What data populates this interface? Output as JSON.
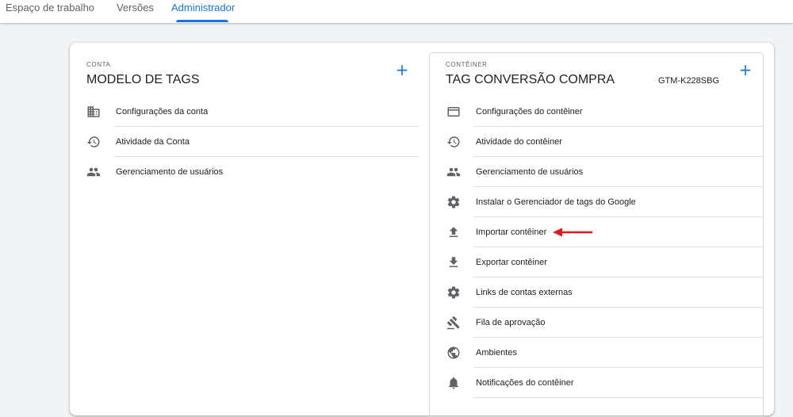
{
  "nav": {
    "tabs": [
      {
        "label": "Espaço de trabalho",
        "active": false
      },
      {
        "label": "Versões",
        "active": false
      },
      {
        "label": "Administrador",
        "active": true
      }
    ]
  },
  "account": {
    "eyebrow": "CONTA",
    "title": "MODELO DE TAGS",
    "add_label": "+",
    "items": [
      {
        "label": "Configurações da conta",
        "icon": "building-icon"
      },
      {
        "label": "Atividade da Conta",
        "icon": "history-icon"
      },
      {
        "label": "Gerenciamento de usuários",
        "icon": "people-icon"
      }
    ]
  },
  "container": {
    "eyebrow": "CONTÊINER",
    "title": "TAG CONVERSÃO COMPRA",
    "id": "GTM-K228SBG",
    "add_label": "+",
    "items": [
      {
        "label": "Configurações do contêiner",
        "icon": "window-icon"
      },
      {
        "label": "Atividade do contêiner",
        "icon": "history-icon"
      },
      {
        "label": "Gerenciamento de usuários",
        "icon": "people-icon"
      },
      {
        "label": "Instalar o Gerenciador de tags do Google",
        "icon": "gear-icon"
      },
      {
        "label": "Importar contêiner",
        "icon": "upload-icon"
      },
      {
        "label": "Exportar contêiner",
        "icon": "download-icon"
      },
      {
        "label": "Links de contas externas",
        "icon": "gear-icon"
      },
      {
        "label": "Fila de aprovação",
        "icon": "gavel-icon"
      },
      {
        "label": "Ambientes",
        "icon": "globe-icon"
      },
      {
        "label": "Notificações do contêiner",
        "icon": "bell-icon"
      }
    ]
  },
  "annotation": {
    "arrow_color": "#e8141b",
    "points_to": "Importar contêiner"
  },
  "colors": {
    "accent": "#1a73e8",
    "icon": "#5f6368",
    "background": "#f1f3f4"
  }
}
